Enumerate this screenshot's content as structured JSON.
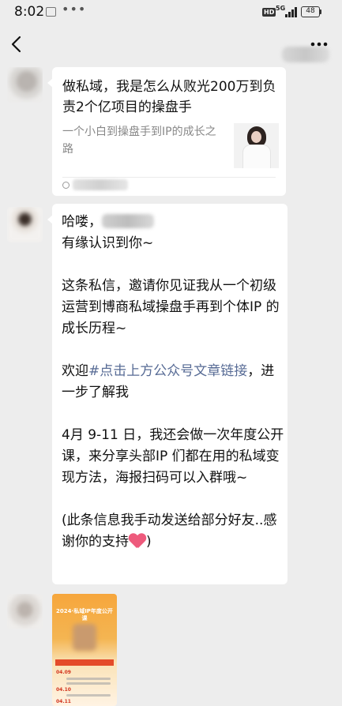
{
  "status_bar": {
    "time": "8:02",
    "dots": "•••",
    "hd": "HD",
    "network": "5G",
    "battery": "48"
  },
  "nav": {
    "title": "",
    "back_icon": "chevron-left-icon",
    "more_icon": "more-horizontal-icon"
  },
  "messages": {
    "link_card": {
      "title": "做私域，我是怎么从败光200万到负责2个亿项目的操盘手",
      "description": "一个小白到操盘手到IP的成长之路",
      "source": ""
    },
    "text_message": {
      "greeting": "哈喽，",
      "line2": "有缘认识到你~",
      "para2": "这条私信，邀请你见证我从一个初级运营到博商私域操盘手再到个体IP 的成长历程~",
      "welcome_prefix": "欢迎",
      "welcome_link": "#点击上方公众号文章链接",
      "welcome_suffix": "，进一步了解我",
      "para4": "4月 9-11 日，我还会做一次年度公开课，来分享头部IP 们都在用的私域变现方法，海报扫码可以入群哦~",
      "para5": "(此条信息我手动发送给部分好友..感谢你的支持"
    },
    "poster": {
      "title": "2024·私域IP年度公开课",
      "dates": [
        "04.09",
        "04.10",
        "04.11"
      ]
    }
  },
  "colors": {
    "chat_background": "#ededed",
    "bubble": "#ffffff",
    "link": "#576b95",
    "poster_orange": "#f6a63c"
  }
}
